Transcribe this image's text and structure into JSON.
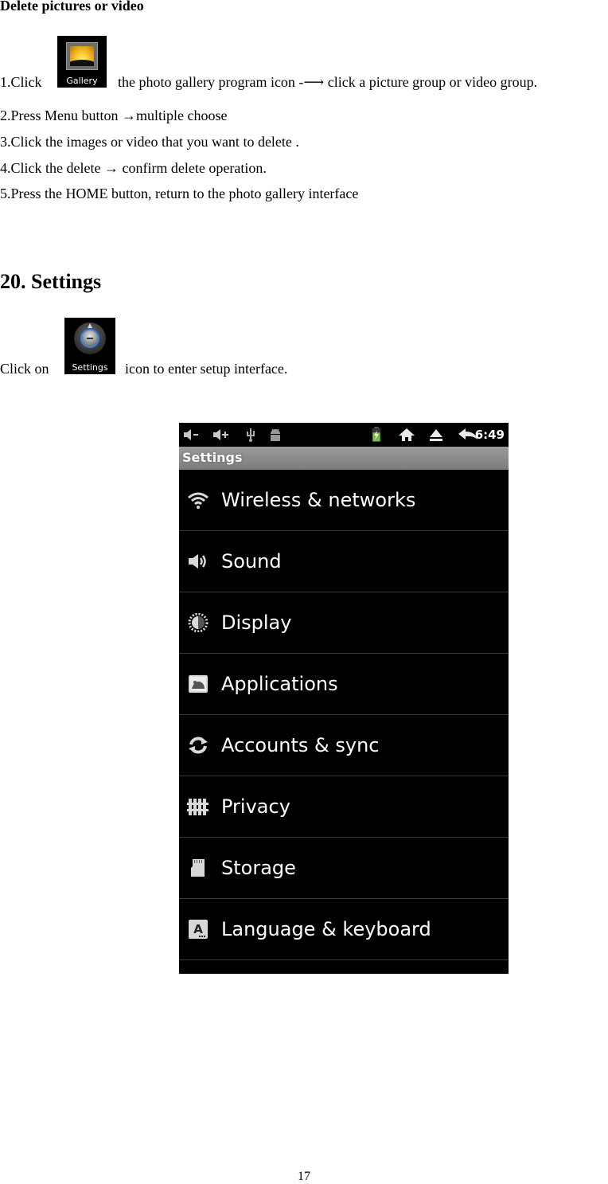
{
  "section_heading": "Delete pictures or video",
  "steps": {
    "step1_before": "1.Click",
    "gallery_icon_label": "Gallery",
    "step1_after": "the photo gallery    program icon -⟶ click a picture group or video group.",
    "step2": "2.Press Menu button →multiple choose",
    "step3": "3.Click the images or video that you want to delete .",
    "step4": "4.Click the delete → confirm delete operation.",
    "step5": "5.Press the HOME button, return to the photo gallery    interface"
  },
  "settings_section": {
    "heading": "20. Settings",
    "click_on": "Click on",
    "settings_icon_label": "Settings",
    "after_icon": "icon to enter setup interface."
  },
  "phone_screenshot": {
    "status_bar": {
      "left_icons": [
        "volume-down-icon",
        "volume-up-icon",
        "usb-icon",
        "android-debug-icon"
      ],
      "right_icons": [
        "battery-charging-icon",
        "home-icon",
        "eject-icon",
        "back-icon"
      ],
      "time": "6:49",
      "battery_color": "#7ac142"
    },
    "title": "Settings",
    "items": [
      {
        "label": "Wireless & networks",
        "icon": "wifi-icon"
      },
      {
        "label": "Sound",
        "icon": "speaker-icon"
      },
      {
        "label": "Display",
        "icon": "brightness-icon"
      },
      {
        "label": "Applications",
        "icon": "applications-icon"
      },
      {
        "label": "Accounts & sync",
        "icon": "sync-icon"
      },
      {
        "label": "Privacy",
        "icon": "fence-icon"
      },
      {
        "label": "Storage",
        "icon": "sd-card-icon"
      },
      {
        "label": "Language & keyboard",
        "icon": "keyboard-icon"
      }
    ]
  },
  "page_number": "17"
}
